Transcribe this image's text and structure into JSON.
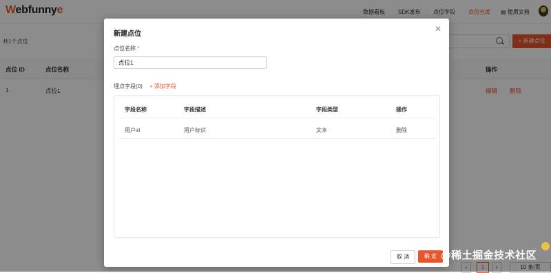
{
  "app": {
    "logo_prefix": "W",
    "logo_mid": "ebfunny",
    "logo_suffix": "e"
  },
  "nav": [
    {
      "label": "数据看板"
    },
    {
      "label": "SDK发布"
    },
    {
      "label": "点位字段"
    },
    {
      "label": "点位仓库"
    },
    {
      "label": "使用文档"
    }
  ],
  "list": {
    "count": "共1个点位",
    "new_button": "+ 新建点位",
    "columns": [
      "点位 ID",
      "点位名称",
      "操作"
    ],
    "rows": [
      {
        "id": "1",
        "name": "点位1",
        "edit": "编辑",
        "delete": "删除"
      }
    ],
    "pager": {
      "page": "1",
      "page_size": "10 条/页"
    }
  },
  "modal": {
    "title": "新建点位",
    "name_label": "点位名称",
    "required_mark": "*",
    "name_value": "点位1",
    "fields_label": "埋点字段(0)",
    "add_field": "+ 添加字段",
    "field_columns": [
      "字段名称",
      "字段描述",
      "字段类型",
      "操作"
    ],
    "field_rows": [
      {
        "name": "用户id",
        "desc": "用户标识",
        "type": "文本",
        "action": "删除"
      }
    ],
    "cancel": "取 消",
    "ok": "确 定"
  },
  "watermark": "@稀土掘金技术社区",
  "colors": {
    "accent": "#e8542b"
  }
}
